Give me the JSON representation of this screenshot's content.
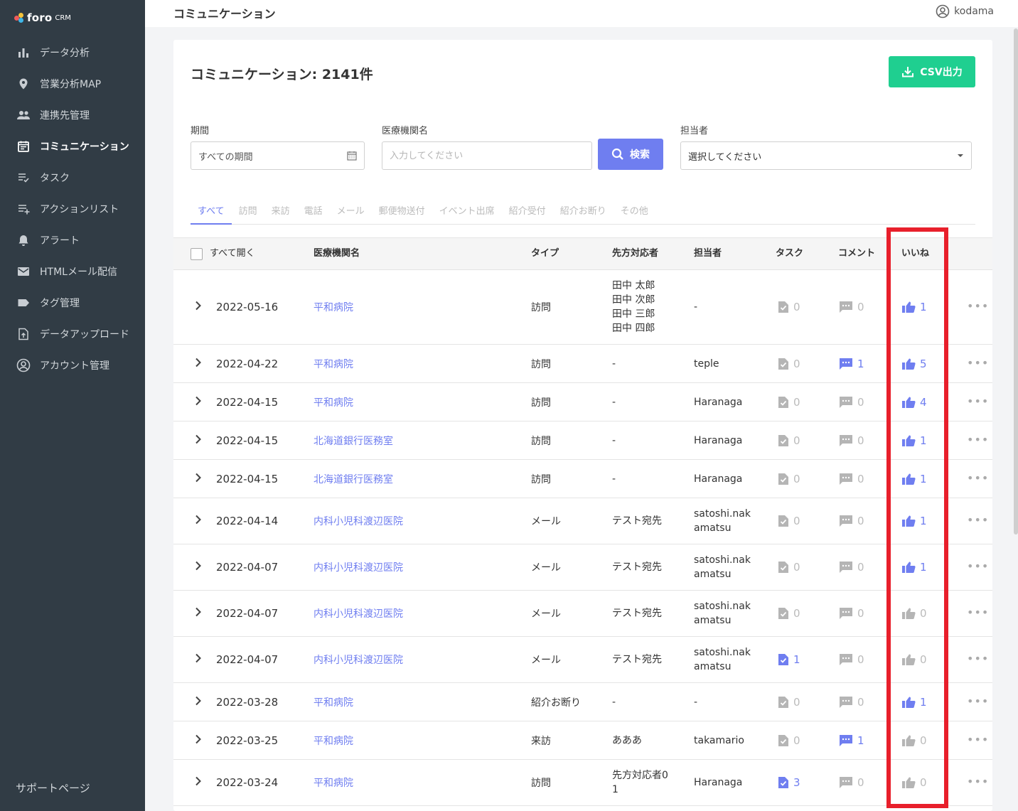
{
  "app": {
    "logo_name": "foro",
    "logo_suffix": "CRM"
  },
  "sidebar": {
    "items": [
      {
        "label": "データ分析",
        "icon": "bar-chart-icon"
      },
      {
        "label": "営業分析MAP",
        "icon": "map-pin-icon"
      },
      {
        "label": "連携先管理",
        "icon": "people-icon"
      },
      {
        "label": "コミュニケーション",
        "icon": "calendar-icon",
        "active": true
      },
      {
        "label": "タスク",
        "icon": "checklist-icon"
      },
      {
        "label": "アクションリスト",
        "icon": "playlist-add-icon"
      },
      {
        "label": "アラート",
        "icon": "bell-icon"
      },
      {
        "label": "HTMLメール配信",
        "icon": "mail-icon"
      },
      {
        "label": "タグ管理",
        "icon": "tag-icon"
      },
      {
        "label": "データアップロード",
        "icon": "upload-file-icon"
      },
      {
        "label": "アカウント管理",
        "icon": "account-icon"
      }
    ],
    "support": "サポートページ"
  },
  "header": {
    "title": "コミュニケーション",
    "user": "kodama"
  },
  "main": {
    "title": "コミュニケーション: 2141件",
    "csv_label": "CSV出力",
    "filters": {
      "period_label": "期間",
      "period_value": "すべての期間",
      "facility_label": "医療機関名",
      "facility_placeholder": "入力してください",
      "search_label": "検索",
      "staff_label": "担当者",
      "staff_value": "選択してください"
    },
    "tabs": [
      "すべて",
      "訪問",
      "来訪",
      "電話",
      "メール",
      "郵便物送付",
      "イベント出席",
      "紹介受付",
      "紹介お断り",
      "その他"
    ],
    "columns": {
      "expand_all": "すべて開く",
      "facility": "医療機関名",
      "type": "タイプ",
      "contact": "先方対応者",
      "staff": "担当者",
      "task": "タスク",
      "comment": "コメント",
      "like": "いいね"
    },
    "rows": [
      {
        "date": "2022-05-16",
        "facility": "平和病院",
        "type": "訪問",
        "contact": "田中 太郎\n田中 次郎\n田中 三郎\n田中 四郎",
        "staff": "-",
        "task": "0",
        "comment": "0",
        "like": "1"
      },
      {
        "date": "2022-04-22",
        "facility": "平和病院",
        "type": "訪問",
        "contact": "-",
        "staff": "teple",
        "task": "0",
        "comment": "1",
        "like": "5"
      },
      {
        "date": "2022-04-15",
        "facility": "平和病院",
        "type": "訪問",
        "contact": "-",
        "staff": "Haranaga",
        "task": "0",
        "comment": "0",
        "like": "4"
      },
      {
        "date": "2022-04-15",
        "facility": "北海道銀行医務室",
        "type": "訪問",
        "contact": "-",
        "staff": "Haranaga",
        "task": "0",
        "comment": "0",
        "like": "1"
      },
      {
        "date": "2022-04-15",
        "facility": "北海道銀行医務室",
        "type": "訪問",
        "contact": "-",
        "staff": "Haranaga",
        "task": "0",
        "comment": "0",
        "like": "1"
      },
      {
        "date": "2022-04-14",
        "facility": "内科小児科渡辺医院",
        "type": "メール",
        "contact": "テスト宛先",
        "staff": "satoshi.nak\namatsu",
        "task": "0",
        "comment": "0",
        "like": "1"
      },
      {
        "date": "2022-04-07",
        "facility": "内科小児科渡辺医院",
        "type": "メール",
        "contact": "テスト宛先",
        "staff": "satoshi.nak\namatsu",
        "task": "0",
        "comment": "0",
        "like": "1"
      },
      {
        "date": "2022-04-07",
        "facility": "内科小児科渡辺医院",
        "type": "メール",
        "contact": "テスト宛先",
        "staff": "satoshi.nak\namatsu",
        "task": "0",
        "comment": "0",
        "like": "0"
      },
      {
        "date": "2022-04-07",
        "facility": "内科小児科渡辺医院",
        "type": "メール",
        "contact": "テスト宛先",
        "staff": "satoshi.nak\namatsu",
        "task": "1",
        "comment": "0",
        "like": "0"
      },
      {
        "date": "2022-03-28",
        "facility": "平和病院",
        "type": "紹介お断り",
        "contact": "-",
        "staff": "-",
        "task": "0",
        "comment": "0",
        "like": "1"
      },
      {
        "date": "2022-03-25",
        "facility": "平和病院",
        "type": "来訪",
        "contact": "あああ",
        "staff": "takamario",
        "task": "0",
        "comment": "1",
        "like": "0"
      },
      {
        "date": "2022-03-24",
        "facility": "平和病院",
        "type": "訪問",
        "contact": "先方対応者0\n1",
        "staff": "Haranaga",
        "task": "3",
        "comment": "0",
        "like": "0"
      }
    ]
  },
  "colors": {
    "sidebar_bg": "#313c45",
    "accent": "#6f7ef0",
    "csv_button": "#1fcf90",
    "highlight": "#e81f2b",
    "inactive_icon": "#bbbbbb"
  }
}
